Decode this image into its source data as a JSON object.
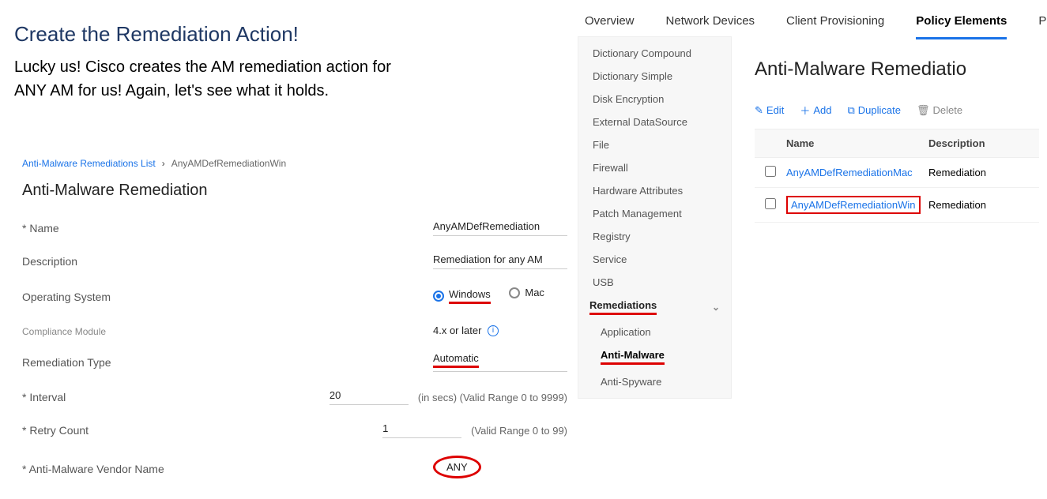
{
  "annotation": {
    "title": "Create the Remediation Action!",
    "body_line1": "Lucky us!  Cisco creates the AM remediation action for",
    "body_line2": "ANY AM for us!  Again, let's see what it holds."
  },
  "tabs": {
    "overview": "Overview",
    "network_devices": "Network Devices",
    "client_provisioning": "Client Provisioning",
    "policy_elements": "Policy Elements",
    "truncated": "P"
  },
  "sidebar": {
    "items": [
      "Dictionary Compound",
      "Dictionary Simple",
      "Disk Encryption",
      "External DataSource",
      "File",
      "Firewall",
      "Hardware Attributes",
      "Patch Management",
      "Registry",
      "Service",
      "USB"
    ],
    "section": "Remediations",
    "subs": {
      "application": "Application",
      "anti_malware": "Anti-Malware",
      "anti_spyware": "Anti-Spyware"
    }
  },
  "list": {
    "title": "Anti-Malware Remediatio",
    "toolbar": {
      "edit": "Edit",
      "add": "Add",
      "duplicate": "Duplicate",
      "delete": "Delete"
    },
    "header": {
      "name": "Name",
      "description": "Description"
    },
    "rows": [
      {
        "name": "AnyAMDefRemediationMac",
        "description": "Remediation "
      },
      {
        "name": "AnyAMDefRemediationWin",
        "description": "Remediation "
      }
    ]
  },
  "form": {
    "breadcrumb": {
      "parent": "Anti-Malware Remediations List",
      "current": "AnyAMDefRemediationWin"
    },
    "title": "Anti-Malware Remediation",
    "fields": {
      "name_label": "* Name",
      "name_value": "AnyAMDefRemediation",
      "desc_label": "Description",
      "desc_value": "Remediation for any AM",
      "os_label": "Operating System",
      "os_windows": "Windows",
      "os_mac": "Mac",
      "compliance_label": "Compliance Module",
      "compliance_value": "4.x or later",
      "remtype_label": "Remediation Type",
      "remtype_value": "Automatic",
      "interval_label": "* Interval",
      "interval_value": "20",
      "interval_hint": "(in secs)  (Valid Range 0 to 9999)",
      "retry_label": "* Retry Count",
      "retry_value": "1",
      "retry_hint": "(Valid Range 0 to 99)",
      "vendor_label": "* Anti-Malware Vendor Name",
      "vendor_value": "ANY"
    }
  }
}
